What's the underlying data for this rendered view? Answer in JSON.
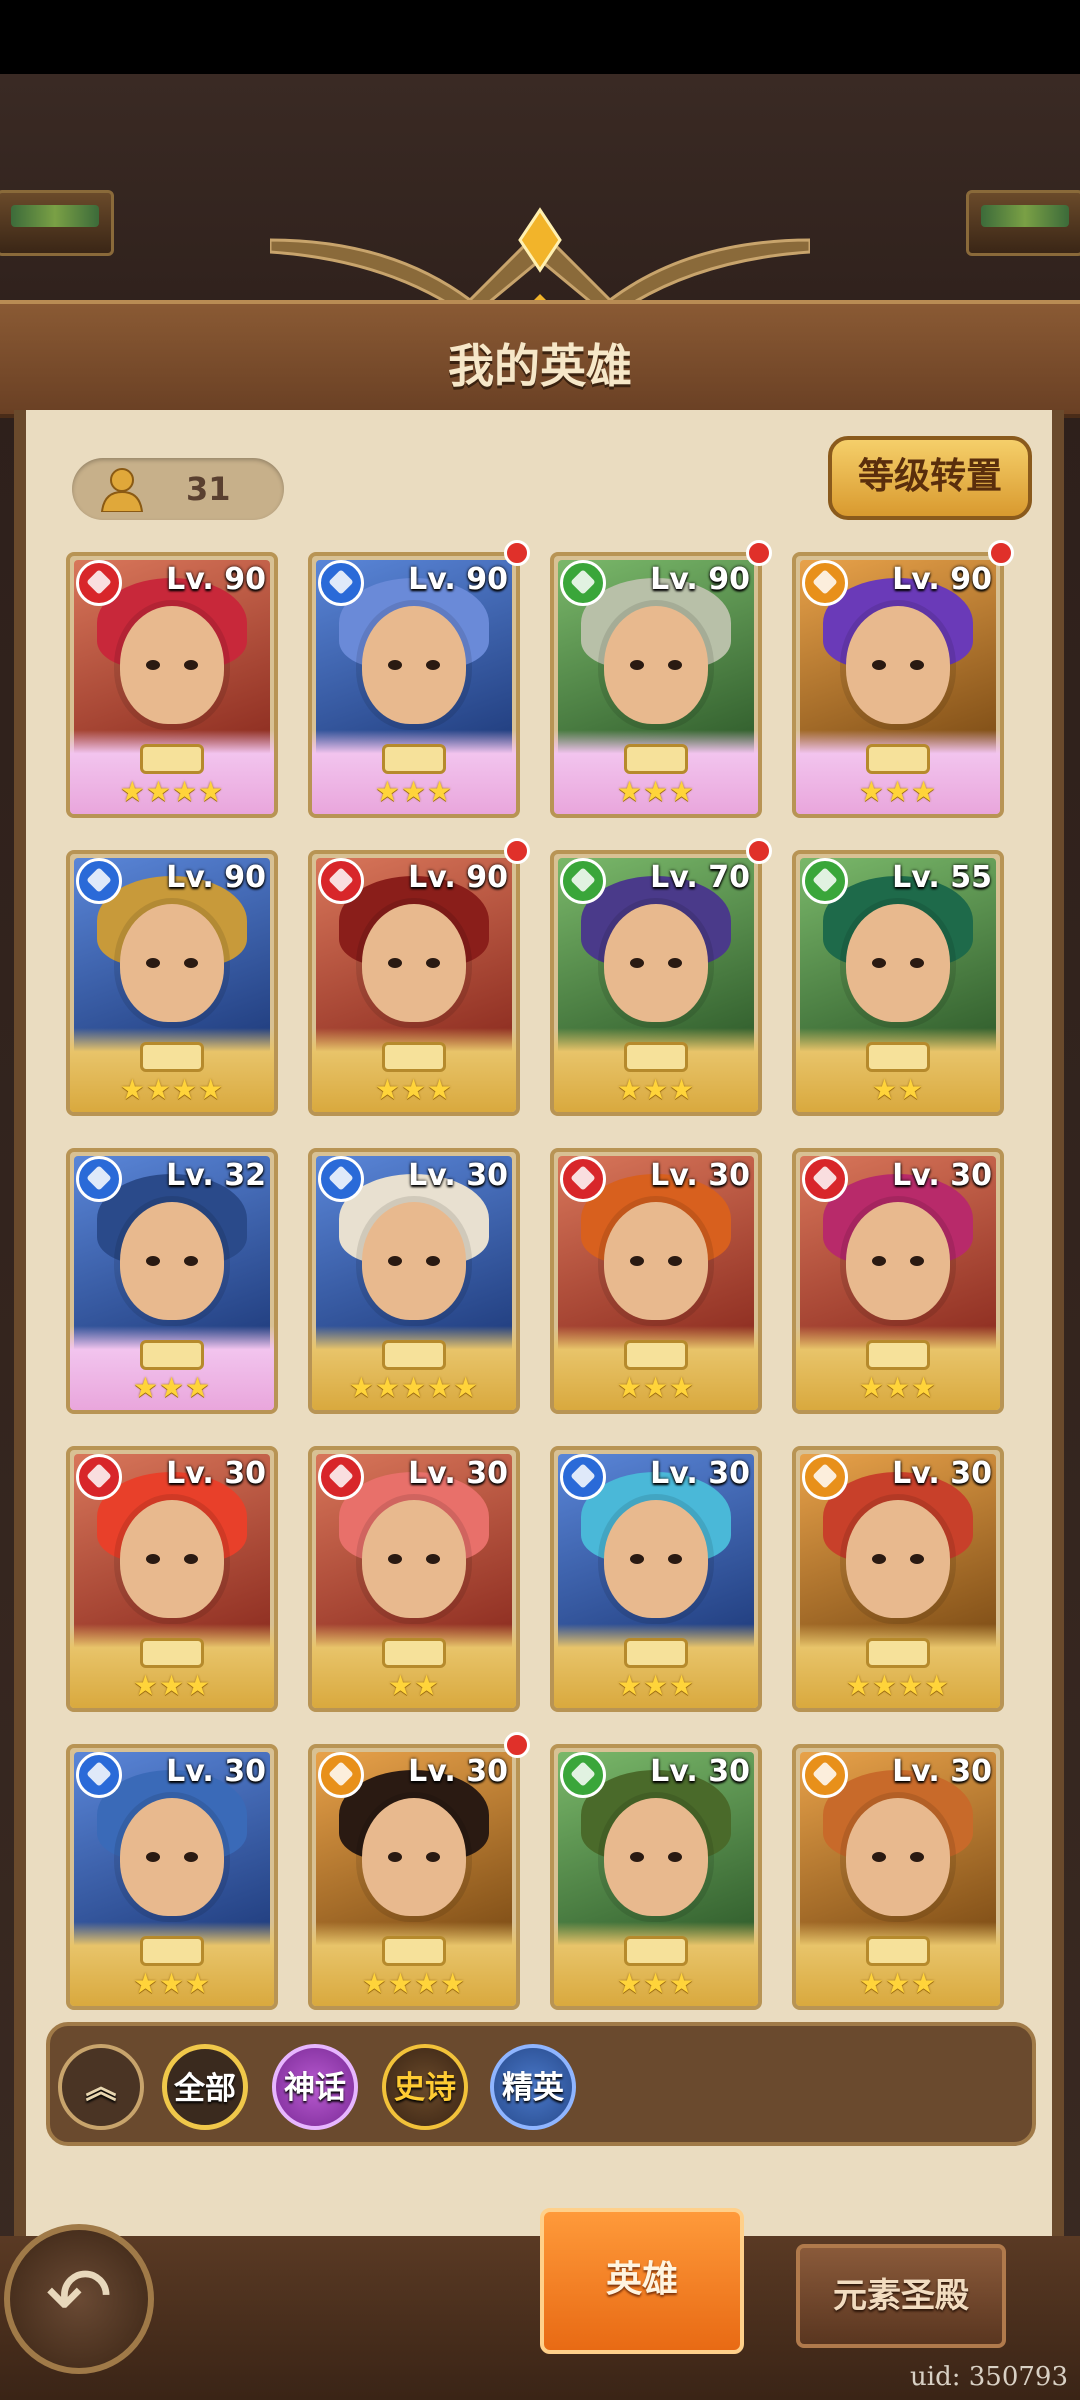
{
  "header": {
    "title": "我的英雄"
  },
  "hero_count": "31",
  "transfer_button": "等级转置",
  "heroes": [
    {
      "level": "Lv. 90",
      "element": "fire",
      "stars": "★★★★",
      "frame": "pink",
      "red_dot": false
    },
    {
      "level": "Lv. 90",
      "element": "water",
      "stars": "★★★",
      "frame": "pink",
      "red_dot": true
    },
    {
      "level": "Lv. 90",
      "element": "wind",
      "stars": "★★★",
      "frame": "pink",
      "red_dot": true
    },
    {
      "level": "Lv. 90",
      "element": "earth",
      "stars": "★★★",
      "frame": "pink",
      "red_dot": true
    },
    {
      "level": "Lv. 90",
      "element": "water",
      "stars": "★★★★",
      "frame": "gold",
      "red_dot": false
    },
    {
      "level": "Lv. 90",
      "element": "fire",
      "stars": "★★★",
      "frame": "gold",
      "red_dot": true
    },
    {
      "level": "Lv. 70",
      "element": "wind",
      "stars": "★★★",
      "frame": "gold",
      "red_dot": true
    },
    {
      "level": "Lv. 55",
      "element": "wind",
      "stars": "★★",
      "frame": "gold",
      "red_dot": false
    },
    {
      "level": "Lv. 32",
      "element": "water",
      "stars": "★★★",
      "frame": "pink",
      "red_dot": false
    },
    {
      "level": "Lv. 30",
      "element": "water",
      "stars": "★★★★★",
      "frame": "gold",
      "red_dot": false
    },
    {
      "level": "Lv. 30",
      "element": "fire",
      "stars": "★★★",
      "frame": "gold",
      "red_dot": false
    },
    {
      "level": "Lv. 30",
      "element": "fire",
      "stars": "★★★",
      "frame": "gold",
      "red_dot": false
    },
    {
      "level": "Lv. 30",
      "element": "fire",
      "stars": "★★★",
      "frame": "gold",
      "red_dot": false
    },
    {
      "level": "Lv. 30",
      "element": "fire",
      "stars": "★★",
      "frame": "gold",
      "red_dot": false
    },
    {
      "level": "Lv. 30",
      "element": "water",
      "stars": "★★★",
      "frame": "gold",
      "red_dot": false
    },
    {
      "level": "Lv. 30",
      "element": "earth",
      "stars": "★★★★",
      "frame": "gold",
      "red_dot": false
    },
    {
      "level": "Lv. 30",
      "element": "water",
      "stars": "★★★",
      "frame": "gold",
      "red_dot": false
    },
    {
      "level": "Lv. 30",
      "element": "earth",
      "stars": "★★★★",
      "frame": "gold",
      "red_dot": true
    },
    {
      "level": "Lv. 30",
      "element": "wind",
      "stars": "★★★",
      "frame": "gold",
      "red_dot": false
    },
    {
      "level": "Lv. 30",
      "element": "earth",
      "stars": "★★★",
      "frame": "gold",
      "red_dot": false
    }
  ],
  "filters": {
    "all": "全部",
    "myth": "神话",
    "epic": "史诗",
    "elite": "精英"
  },
  "tabs": {
    "heroes": "英雄",
    "temple": "元素圣殿"
  },
  "uid": "uid: 350793",
  "colors": {
    "fire": "#d8262a",
    "water": "#2a6ad8",
    "wind": "#3aa63a",
    "earth": "#e8901a"
  }
}
